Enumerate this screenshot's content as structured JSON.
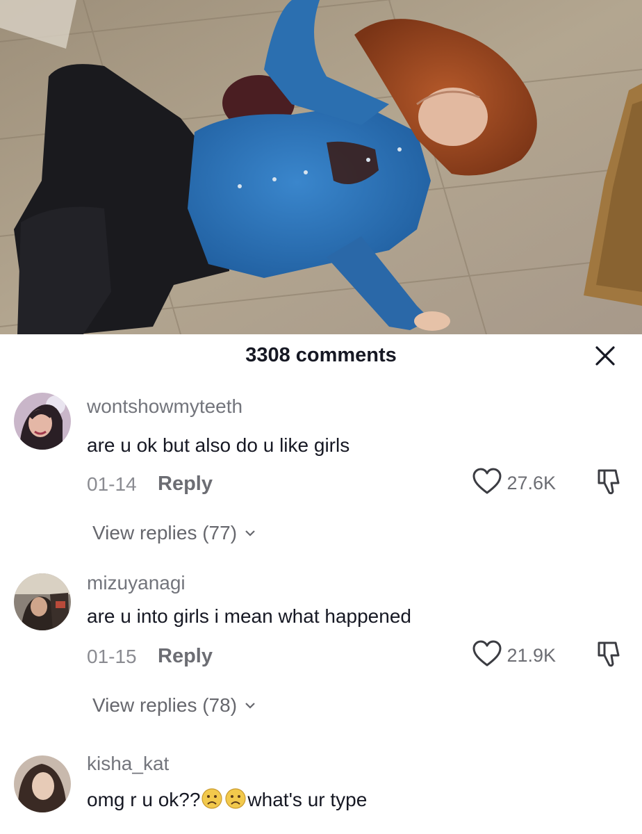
{
  "header": {
    "comment_count": "3308 comments"
  },
  "comments": [
    {
      "username": "wontshowmyteeth",
      "text": "are u ok but also do u like girls",
      "date": "01-14",
      "reply_label": "Reply",
      "likes": "27.6K",
      "view_replies": "View replies (77)"
    },
    {
      "username": "mizuyanagi",
      "text": "are u into girls i mean what happened",
      "date": "01-15",
      "reply_label": "Reply",
      "likes": "21.9K",
      "view_replies": "View replies (78)"
    },
    {
      "username": "kisha_kat",
      "text_before": "omg r u ok??",
      "text_after": "what's ur type"
    }
  ],
  "icons": {
    "close": "close-icon",
    "like": "heart-outline-icon",
    "dislike": "thumbs-down-icon",
    "expand": "chevron-down-icon",
    "emoji": "frowning-face-emoji"
  },
  "colors": {
    "primary_text": "#161823",
    "secondary_text": "#73757c",
    "floor": "#a89a86",
    "shirt": "#2a6fb3"
  }
}
